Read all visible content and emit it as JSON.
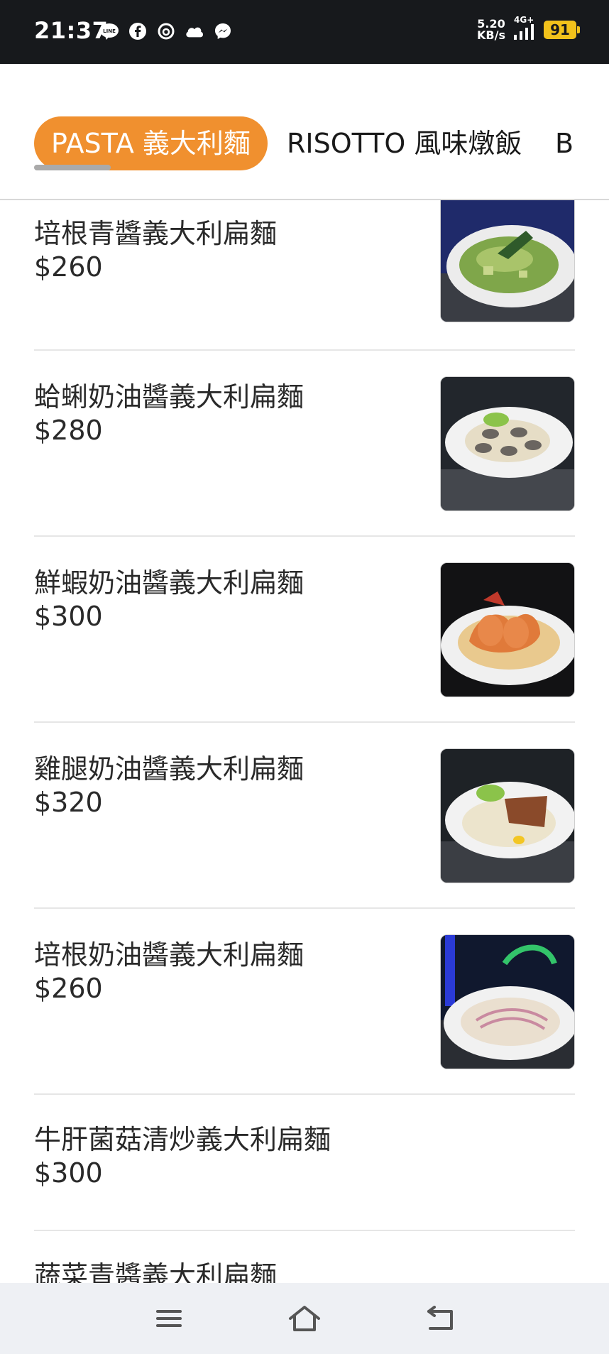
{
  "status_bar": {
    "time": "21:37",
    "net_speed_value": "5.20",
    "net_speed_unit": "KB/s",
    "network_type": "4G+",
    "battery": "91",
    "notification_icons": [
      "line-icon",
      "facebook-icon",
      "threads-icon",
      "cloud-icon",
      "messenger-icon"
    ]
  },
  "tabs": [
    {
      "label": "PASTA 義大利麵",
      "active": true
    },
    {
      "label": "RISOTTO 風味燉飯",
      "active": false
    },
    {
      "label": "B",
      "active": false
    }
  ],
  "menu_items": [
    {
      "name": "培根青醬義大利扁麵",
      "price": "$260",
      "has_photo": true
    },
    {
      "name": "蛤蜊奶油醬義大利扁麵",
      "price": "$280",
      "has_photo": true
    },
    {
      "name": "鮮蝦奶油醬義大利扁麵",
      "price": "$300",
      "has_photo": true
    },
    {
      "name": "雞腿奶油醬義大利扁麵",
      "price": "$320",
      "has_photo": true
    },
    {
      "name": "培根奶油醬義大利扁麵",
      "price": "$260",
      "has_photo": true
    },
    {
      "name": "牛肝菌菇清炒義大利扁麵",
      "price": "$300",
      "has_photo": false
    },
    {
      "name": "蔬菜青醬義大利扁麵",
      "price": "",
      "has_photo": false
    }
  ],
  "nav_bar": {
    "buttons": [
      "menu-icon",
      "home-icon",
      "back-icon"
    ]
  },
  "colors": {
    "accent": "#f0902f",
    "status_bar_bg": "#17191c",
    "battery": "#f2c21b",
    "nav_bar_bg": "#eef0f4"
  }
}
